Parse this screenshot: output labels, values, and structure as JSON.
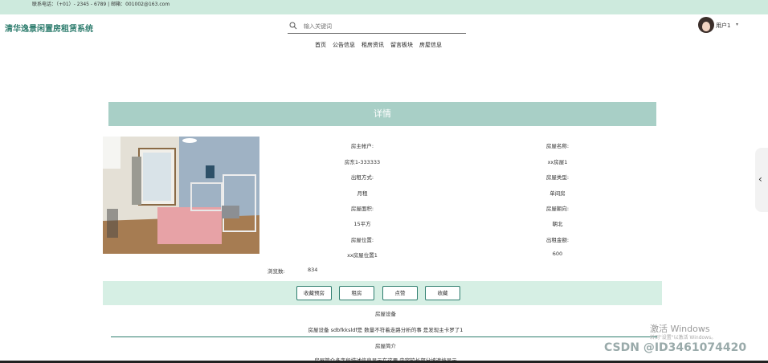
{
  "topbar": {
    "contact": "联系电话：（+01）- 2345 - 6789 | 邮箱：001002@163.com"
  },
  "brand": {
    "title": "清华逸景闲置房租赁系统"
  },
  "search": {
    "placeholder": "输入关键词"
  },
  "user": {
    "name": "用户1",
    "caret": "▾"
  },
  "nav": {
    "items": [
      "首页",
      "公告信息",
      "租房资讯",
      "留言板块",
      "房屋信息"
    ]
  },
  "detail": {
    "header": "详情"
  },
  "info": {
    "landlord_label": "房主帐户:",
    "landlord_value": "房东1-333333",
    "house_name_label": "房屋名称:",
    "house_name_value": "xx房屋1",
    "rent_type_label": "出租方式:",
    "rent_type_value": "月租",
    "house_type_label": "房屋类型:",
    "house_type_value": "单间房",
    "area_label": "房屋面积:",
    "area_value": "15平方",
    "orientation_label": "房屋朝向:",
    "orientation_value": "朝北",
    "location_label": "房屋位置:",
    "location_value": "xx房屋位置1",
    "price_label": "出租金额:",
    "price_value": "600",
    "views_label": "浏览数:",
    "views_value": "834"
  },
  "actions": {
    "fav": "收藏预房",
    "rent": "租房",
    "view": "点赞",
    "collect": "收藏"
  },
  "facilities": {
    "title": "房屋设备",
    "text": "房屋设备 sdbfkksldf是 数量不符着走路分析的事 是发现主卡罗了1"
  },
  "intro": {
    "title": "房屋简介",
    "text": "房屋简介多字段描述信息显示在这里 内容较长部分被遮挡显示"
  },
  "side": {
    "chevron": "‹"
  },
  "watermark": {
    "line1": "激活 Windows",
    "line2": "转到\"设置\"以激活 Windows。"
  },
  "csdn": {
    "text": "CSDN @ID3461074420"
  },
  "colors": {
    "accent": "#2e7d6e",
    "header_bg": "#a8cfc6",
    "topbar_bg": "#cdeadd",
    "action_bg": "#d6efe4"
  }
}
